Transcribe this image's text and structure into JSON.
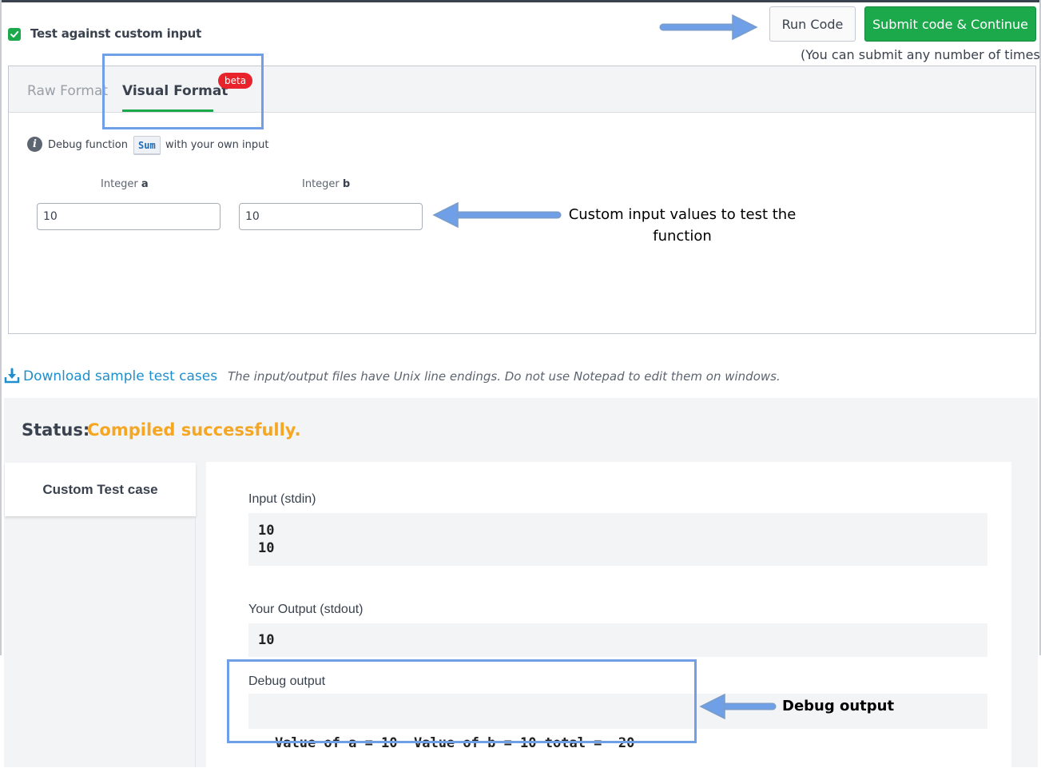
{
  "header": {
    "custom_input_label": "Test against custom input",
    "run_label": "Run Code",
    "submit_label": "Submit code & Continue",
    "submit_note": "(You can submit any number of times)"
  },
  "tabs": {
    "raw": "Raw Format",
    "visual": "Visual Format",
    "beta": "beta"
  },
  "debug_hint": {
    "prefix": "Debug function",
    "function_name": "Sum",
    "suffix": "with your own input"
  },
  "inputs": {
    "a_label_prefix": "Integer",
    "a_name": "a",
    "a_value": "10",
    "b_label_prefix": "Integer",
    "b_name": "b",
    "b_value": "10"
  },
  "annotations": {
    "custom_input": "Custom input values to test the function",
    "debug_output": "Debug output"
  },
  "download": {
    "link": "Download sample test cases",
    "note": "The input/output files have Unix line endings. Do not use Notepad to edit them on windows."
  },
  "status": {
    "label": "Status:",
    "value": "Compiled successfully."
  },
  "results": {
    "tab": "Custom Test case",
    "input_title": "Input (stdin)",
    "input_lines": [
      "10",
      "10"
    ],
    "output_title": "Your Output (stdout)",
    "output_lines": [
      "10"
    ],
    "debug_title": "Debug output",
    "debug_lines": [
      "Value of a = 10  Value of b = 10 total =  20"
    ]
  },
  "colors": {
    "accent_green": "#1ba94c",
    "status_orange": "#f5a623",
    "annotation_blue": "#6f9fe6",
    "link_blue": "#1e8fcc",
    "beta_red": "#e8232b"
  }
}
